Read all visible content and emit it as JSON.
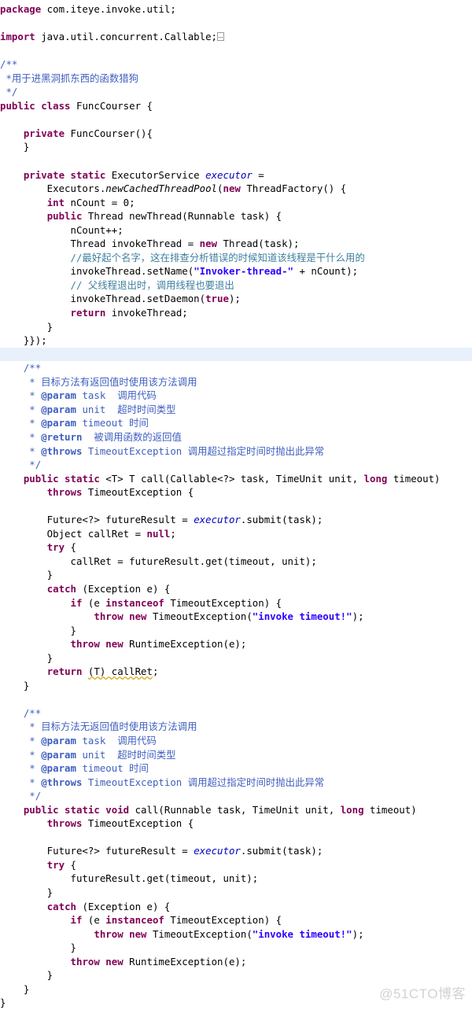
{
  "document": {
    "language": "java",
    "class_name": "FuncCourser",
    "package": "com.iteye.invoke.util",
    "watermark": "@51CTO博客",
    "colors": {
      "background": "#ffffff",
      "keyword": "#7f0055",
      "string": "#2a00ff",
      "line_comment": "#3f7f9f",
      "javadoc": "#3f5fbf",
      "field": "#0000c0",
      "plain": "#000000",
      "highlight_line": "#e8f0fc",
      "warning_underline": "#d8a61a",
      "watermark": "#d2d2d2"
    }
  },
  "code_lines": [
    {
      "id": 1,
      "text": "package com.iteye.invoke.util;"
    },
    {
      "id": 2,
      "text": ""
    },
    {
      "id": 3,
      "text": "import java.util.concurrent.Callable;"
    },
    {
      "id": 4,
      "text": ""
    },
    {
      "id": 5,
      "text": "/**"
    },
    {
      "id": 6,
      "text": " *用于进黑洞抓东西的函数猎狗"
    },
    {
      "id": 7,
      "text": " */"
    },
    {
      "id": 8,
      "text": "public class FuncCourser {"
    },
    {
      "id": 9,
      "text": ""
    },
    {
      "id": 10,
      "text": "    private FuncCourser(){"
    },
    {
      "id": 11,
      "text": "    }"
    },
    {
      "id": 12,
      "text": ""
    },
    {
      "id": 13,
      "text": "    private static ExecutorService executor ="
    },
    {
      "id": 14,
      "text": "        Executors.newCachedThreadPool(new ThreadFactory() {"
    },
    {
      "id": 15,
      "text": "        int nCount = 0;"
    },
    {
      "id": 16,
      "text": "        public Thread newThread(Runnable task) {"
    },
    {
      "id": 17,
      "text": "            nCount++;"
    },
    {
      "id": 18,
      "text": "            Thread invokeThread = new Thread(task);"
    },
    {
      "id": 19,
      "text": "            //最好起个名字，这在排查分析错误的时候知道该线程是干什么用的"
    },
    {
      "id": 20,
      "text": "            invokeThread.setName(\"Invoker-thread-\" + nCount);"
    },
    {
      "id": 21,
      "text": "            // 父线程退出时，调用线程也要退出"
    },
    {
      "id": 22,
      "text": "            invokeThread.setDaemon(true);"
    },
    {
      "id": 23,
      "text": "            return invokeThread;"
    },
    {
      "id": 24,
      "text": "        }"
    },
    {
      "id": 25,
      "text": "    }});"
    },
    {
      "id": 26,
      "text": "",
      "highlight": true
    },
    {
      "id": 27,
      "text": "    /**"
    },
    {
      "id": 28,
      "text": "     * 目标方法有返回值时使用该方法调用"
    },
    {
      "id": 29,
      "text": "     * @param task  调用代码"
    },
    {
      "id": 30,
      "text": "     * @param unit  超时时间类型"
    },
    {
      "id": 31,
      "text": "     * @param timeout 时间"
    },
    {
      "id": 32,
      "text": "     * @return  被调用函数的返回值"
    },
    {
      "id": 33,
      "text": "     * @throws TimeoutException 调用超过指定时间时抛出此异常"
    },
    {
      "id": 34,
      "text": "     */"
    },
    {
      "id": 35,
      "text": "    public static <T> T call(Callable<?> task, TimeUnit unit, long timeout)"
    },
    {
      "id": 36,
      "text": "        throws TimeoutException {"
    },
    {
      "id": 37,
      "text": ""
    },
    {
      "id": 38,
      "text": "        Future<?> futureResult = executor.submit(task);"
    },
    {
      "id": 39,
      "text": "        Object callRet = null;"
    },
    {
      "id": 40,
      "text": "        try {"
    },
    {
      "id": 41,
      "text": "            callRet = futureResult.get(timeout, unit);"
    },
    {
      "id": 42,
      "text": "        }"
    },
    {
      "id": 43,
      "text": "        catch (Exception e) {"
    },
    {
      "id": 44,
      "text": "            if (e instanceof TimeoutException) {"
    },
    {
      "id": 45,
      "text": "                throw new TimeoutException(\"invoke timeout!\");"
    },
    {
      "id": 46,
      "text": "            }"
    },
    {
      "id": 47,
      "text": "            throw new RuntimeException(e);"
    },
    {
      "id": 48,
      "text": "        }"
    },
    {
      "id": 49,
      "text": "        return (T) callRet;"
    },
    {
      "id": 50,
      "text": "    }"
    },
    {
      "id": 51,
      "text": ""
    },
    {
      "id": 52,
      "text": "    /**"
    },
    {
      "id": 53,
      "text": "     * 目标方法无返回值时使用该方法调用"
    },
    {
      "id": 54,
      "text": "     * @param task  调用代码"
    },
    {
      "id": 55,
      "text": "     * @param unit  超时时间类型"
    },
    {
      "id": 56,
      "text": "     * @param timeout 时间"
    },
    {
      "id": 57,
      "text": "     * @throws TimeoutException 调用超过指定时间时抛出此异常"
    },
    {
      "id": 58,
      "text": "     */"
    },
    {
      "id": 59,
      "text": "    public static void call(Runnable task, TimeUnit unit, long timeout)"
    },
    {
      "id": 60,
      "text": "        throws TimeoutException {"
    },
    {
      "id": 61,
      "text": ""
    },
    {
      "id": 62,
      "text": "        Future<?> futureResult = executor.submit(task);"
    },
    {
      "id": 63,
      "text": "        try {"
    },
    {
      "id": 64,
      "text": "            futureResult.get(timeout, unit);"
    },
    {
      "id": 65,
      "text": "        }"
    },
    {
      "id": 66,
      "text": "        catch (Exception e) {"
    },
    {
      "id": 67,
      "text": "            if (e instanceof TimeoutException) {"
    },
    {
      "id": 68,
      "text": "                throw new TimeoutException(\"invoke timeout!\");"
    },
    {
      "id": 69,
      "text": "            }"
    },
    {
      "id": 70,
      "text": "            throw new RuntimeException(e);"
    },
    {
      "id": 71,
      "text": "        }"
    },
    {
      "id": 72,
      "text": "    }"
    },
    {
      "id": 73,
      "text": "}"
    }
  ],
  "tokens": {
    "l1": [
      [
        "kw",
        "package"
      ],
      [
        "plain",
        " com.iteye.invoke.util;"
      ]
    ],
    "l3": [
      [
        "kw",
        "import"
      ],
      [
        "plain",
        " java.util.concurrent.Callable;"
      ]
    ],
    "l5": [
      [
        "jdoc",
        "/**"
      ]
    ],
    "l6": [
      [
        "jdoc",
        " *用于进黑洞抓东西的函数猎狗"
      ]
    ],
    "l7": [
      [
        "jdoc",
        " */"
      ]
    ],
    "l8": [
      [
        "kw",
        "public class"
      ],
      [
        "plain",
        " FuncCourser {"
      ]
    ],
    "l10": [
      [
        "plain",
        "    "
      ],
      [
        "kw",
        "private"
      ],
      [
        "plain",
        " FuncCourser(){"
      ]
    ],
    "l13": [
      [
        "plain",
        "    "
      ],
      [
        "kw",
        "private static"
      ],
      [
        "plain",
        " ExecutorService "
      ],
      [
        "fld",
        "executor"
      ],
      [
        "plain",
        " ="
      ]
    ],
    "l14": [
      [
        "plain",
        "        Executors."
      ],
      [
        "mth",
        "newCachedThreadPool"
      ],
      [
        "plain",
        "("
      ],
      [
        "kw",
        "new"
      ],
      [
        "plain",
        " ThreadFactory() {"
      ]
    ],
    "l15": [
      [
        "plain",
        "        "
      ],
      [
        "kw",
        "int"
      ],
      [
        "plain",
        " nCount = 0;"
      ]
    ],
    "l16": [
      [
        "plain",
        "        "
      ],
      [
        "kw",
        "public"
      ],
      [
        "plain",
        " Thread newThread(Runnable task) {"
      ]
    ],
    "l18": [
      [
        "plain",
        "            Thread invokeThread = "
      ],
      [
        "kw",
        "new"
      ],
      [
        "plain",
        " Thread(task);"
      ]
    ],
    "l19": [
      [
        "cmt",
        "            //最好起个名字，这在排查分析错误的时候知道该线程是干什么用的"
      ]
    ],
    "l20": [
      [
        "plain",
        "            invokeThread.setName("
      ],
      [
        "str",
        "\"Invoker-thread-\""
      ],
      [
        "plain",
        " + nCount);"
      ]
    ],
    "l21": [
      [
        "cmt",
        "            // 父线程退出时，调用线程也要退出"
      ]
    ],
    "l22": [
      [
        "plain",
        "            invokeThread.setDaemon("
      ],
      [
        "kw",
        "true"
      ],
      [
        "plain",
        ");"
      ]
    ],
    "l23": [
      [
        "plain",
        "            "
      ],
      [
        "kw",
        "return"
      ],
      [
        "plain",
        " invokeThread;"
      ]
    ],
    "l35": [
      [
        "plain",
        "    "
      ],
      [
        "kw",
        "public static"
      ],
      [
        "plain",
        " <T> T call(Callable<?> task, TimeUnit unit, "
      ],
      [
        "kw",
        "long"
      ],
      [
        "plain",
        " timeout)"
      ]
    ],
    "l36": [
      [
        "plain",
        "        "
      ],
      [
        "kw",
        "throws"
      ],
      [
        "plain",
        " TimeoutException {"
      ]
    ],
    "l38": [
      [
        "plain",
        "        Future<?> futureResult = "
      ],
      [
        "fld",
        "executor"
      ],
      [
        "plain",
        ".submit(task);"
      ]
    ],
    "l39": [
      [
        "plain",
        "        Object callRet = "
      ],
      [
        "kw",
        "null"
      ],
      [
        "plain",
        ";"
      ]
    ],
    "l40": [
      [
        "plain",
        "        "
      ],
      [
        "kw",
        "try"
      ],
      [
        "plain",
        " {"
      ]
    ],
    "l43": [
      [
        "plain",
        "        "
      ],
      [
        "kw",
        "catch"
      ],
      [
        "plain",
        " (Exception e) {"
      ]
    ],
    "l44": [
      [
        "plain",
        "            "
      ],
      [
        "kw",
        "if"
      ],
      [
        "plain",
        " (e "
      ],
      [
        "kw",
        "instanceof"
      ],
      [
        "plain",
        " TimeoutException) {"
      ]
    ],
    "l45": [
      [
        "plain",
        "                "
      ],
      [
        "kw",
        "throw new"
      ],
      [
        "plain",
        " TimeoutException("
      ],
      [
        "str",
        "\"invoke timeout!\""
      ],
      [
        "plain",
        ");"
      ]
    ],
    "l47": [
      [
        "plain",
        "            "
      ],
      [
        "kw",
        "throw new"
      ],
      [
        "plain",
        " RuntimeException(e);"
      ]
    ],
    "l49": [
      [
        "plain",
        "        "
      ],
      [
        "kw",
        "return"
      ],
      [
        "plain",
        " "
      ],
      [
        "warn",
        "(T) callRet"
      ],
      [
        "plain",
        ";"
      ]
    ],
    "l59": [
      [
        "plain",
        "    "
      ],
      [
        "kw",
        "public static void"
      ],
      [
        "plain",
        " call(Runnable task, TimeUnit unit, "
      ],
      [
        "kw",
        "long"
      ],
      [
        "plain",
        " timeout)"
      ]
    ]
  }
}
